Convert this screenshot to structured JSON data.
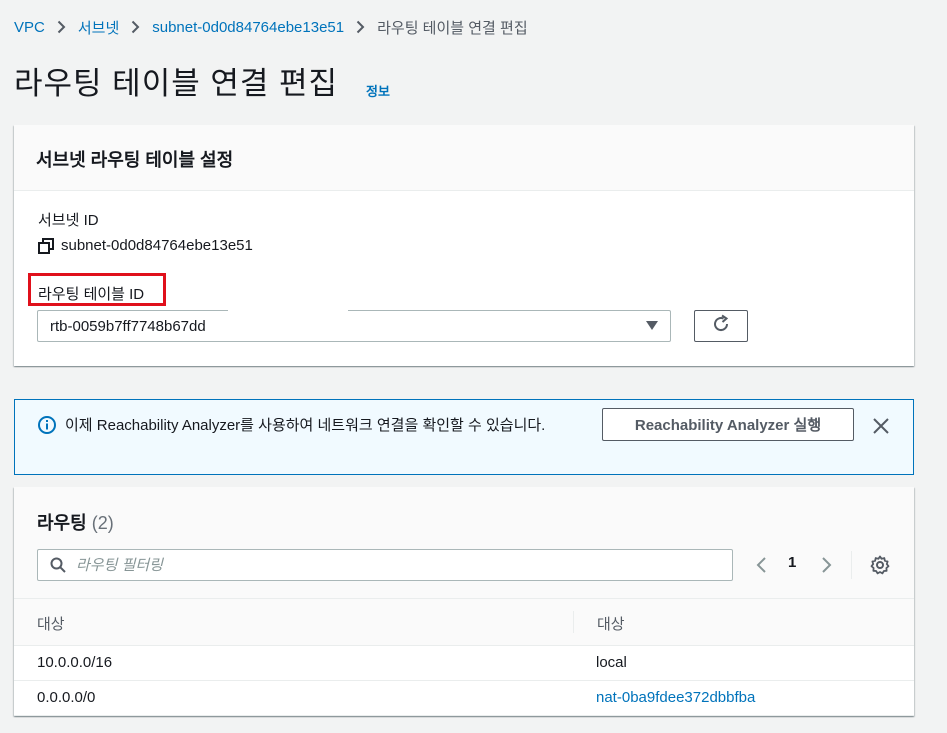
{
  "breadcrumb": {
    "items": [
      "VPC",
      "서브넷",
      "subnet-0d0d84764ebe13e51"
    ],
    "current": "라우팅 테이블 연결 편집"
  },
  "page": {
    "title": "라우팅 테이블 연결 편집",
    "info_link": "정보"
  },
  "settings": {
    "header": "서브넷 라우팅 테이블 설정",
    "subnet_id_label": "서브넷 ID",
    "subnet_id_value": "subnet-0d0d84764ebe13e51",
    "route_table_label": "라우팅 테이블 ID",
    "route_table_selected": "rtb-0059b7ff7748b67dd"
  },
  "alert": {
    "text": "이제 Reachability Analyzer를 사용하여 네트워크 연결을 확인할 수 있습니다.",
    "button": "Reachability Analyzer 실행"
  },
  "routes": {
    "title": "라우팅",
    "count": "(2)",
    "search_placeholder": "라우팅 필터링",
    "page_number": "1",
    "columns": [
      "대상",
      "대상"
    ],
    "rows": [
      {
        "destination": "10.0.0.0/16",
        "target": "local"
      },
      {
        "destination": "0.0.0.0/0",
        "target": "nat-0ba9fdee372dbbfba"
      }
    ]
  },
  "colors": {
    "link": "#0073bb",
    "highlight": "#e0101b",
    "alert_bg": "#f1faff",
    "page_bg": "#f2f3f3"
  }
}
